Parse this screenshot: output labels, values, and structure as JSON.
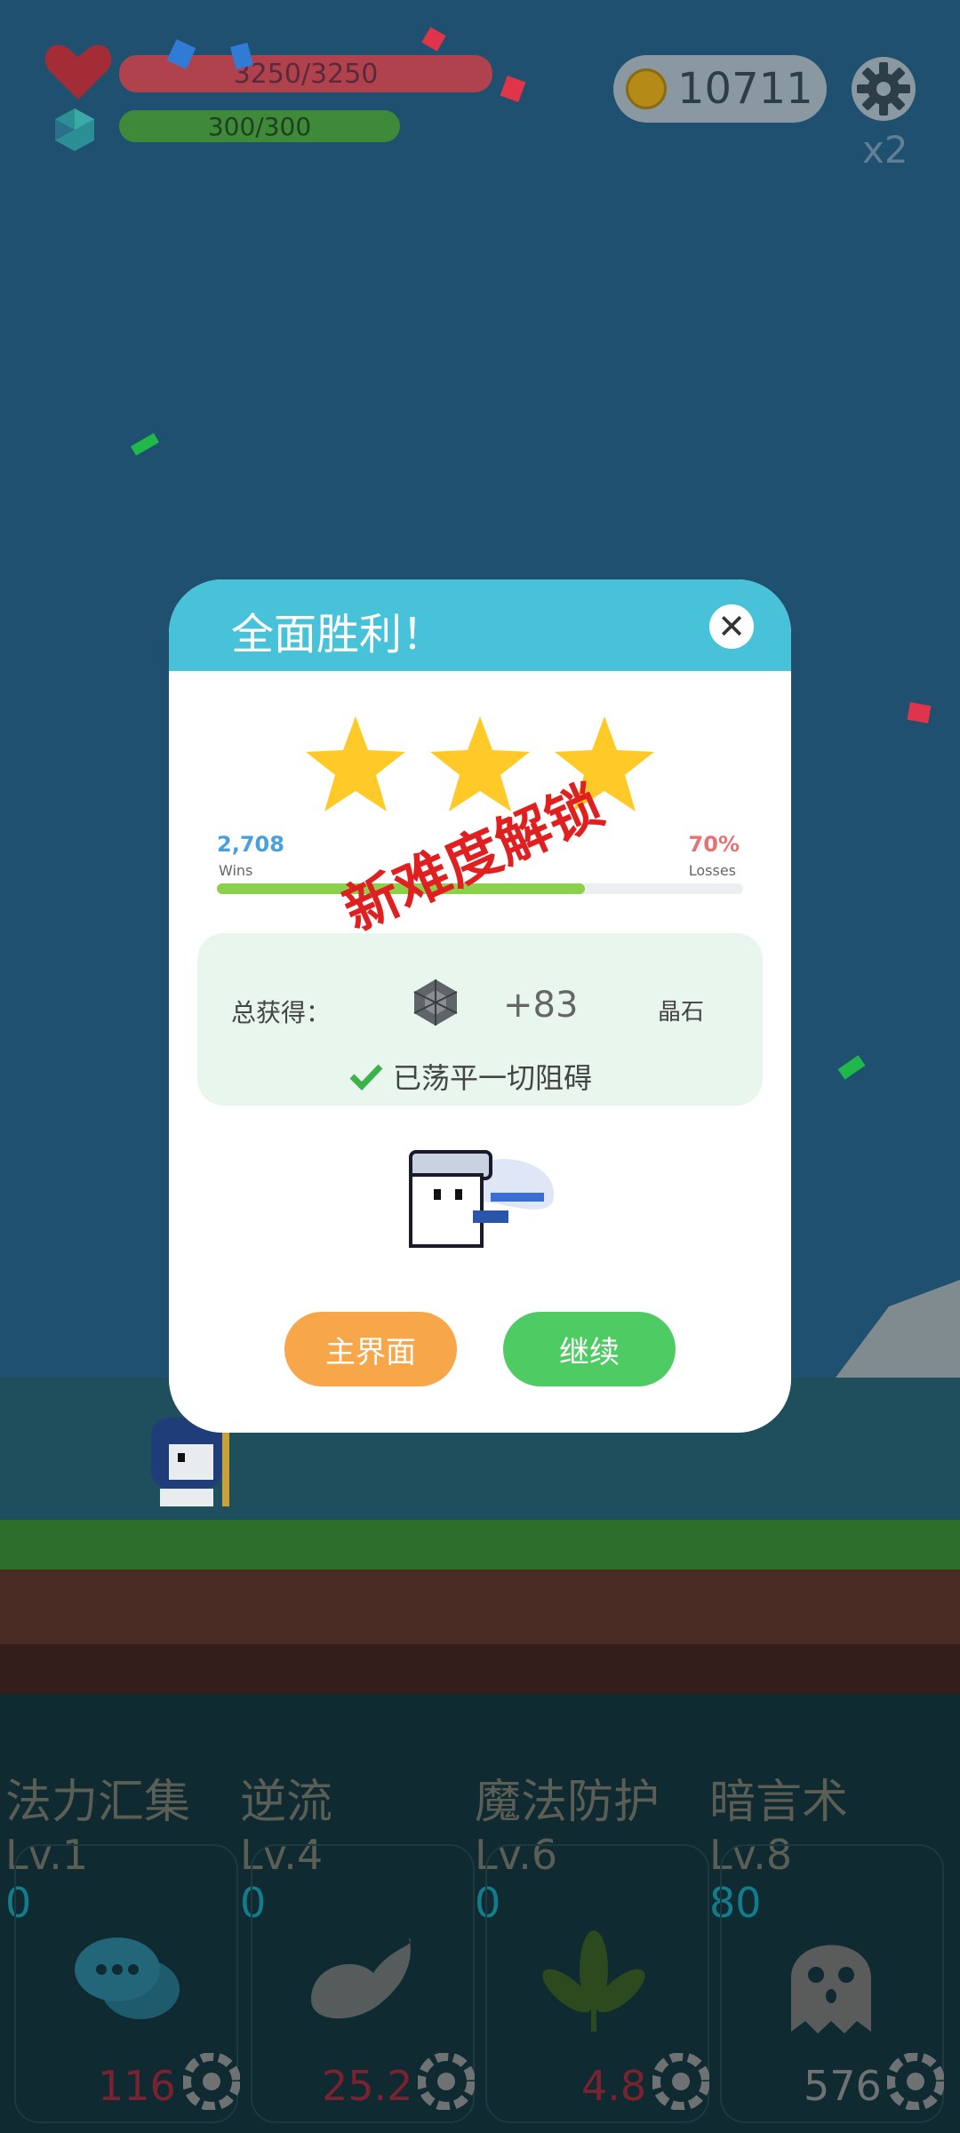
{
  "hud": {
    "hp_text": "3250/3250",
    "mp_text": "300/300",
    "coins": "10711",
    "speed": "x2"
  },
  "modal": {
    "title": "全面胜利！",
    "close_icon": "close-icon",
    "stars": 3,
    "wins_value": "2,708",
    "wins_label": "Wins",
    "losses_value": "70%",
    "losses_label": "Losses",
    "progress_fraction": 0.7,
    "stamp": "新难度解锁",
    "reward_label": "总获得：",
    "reward_amount": "+83",
    "reward_unit": "晶石",
    "cleared_text": "已荡平一切阻碍",
    "btn_main": "主界面",
    "btn_continue": "继续"
  },
  "skills": [
    {
      "name": "法力汇集",
      "level": "Lv.1",
      "value": "0",
      "cost": "116",
      "icon": "chat-bubbles-icon"
    },
    {
      "name": "逆流",
      "level": "Lv.4",
      "value": "0",
      "cost": "25.2",
      "icon": "swirl-icon"
    },
    {
      "name": "魔法防护",
      "level": "Lv.6",
      "value": "0",
      "cost": "4.8",
      "icon": "leaf-icon"
    },
    {
      "name": "暗言术",
      "level": "Lv.8",
      "value": "80",
      "cost": "576",
      "icon": "ghost-icon"
    }
  ],
  "colors": {
    "sky": "#1f506f",
    "modal_header": "#47c2d9",
    "star": "#ffc928",
    "btn_main": "#f8a64a",
    "btn_continue": "#4fcb63",
    "stamp": "#e02020"
  }
}
